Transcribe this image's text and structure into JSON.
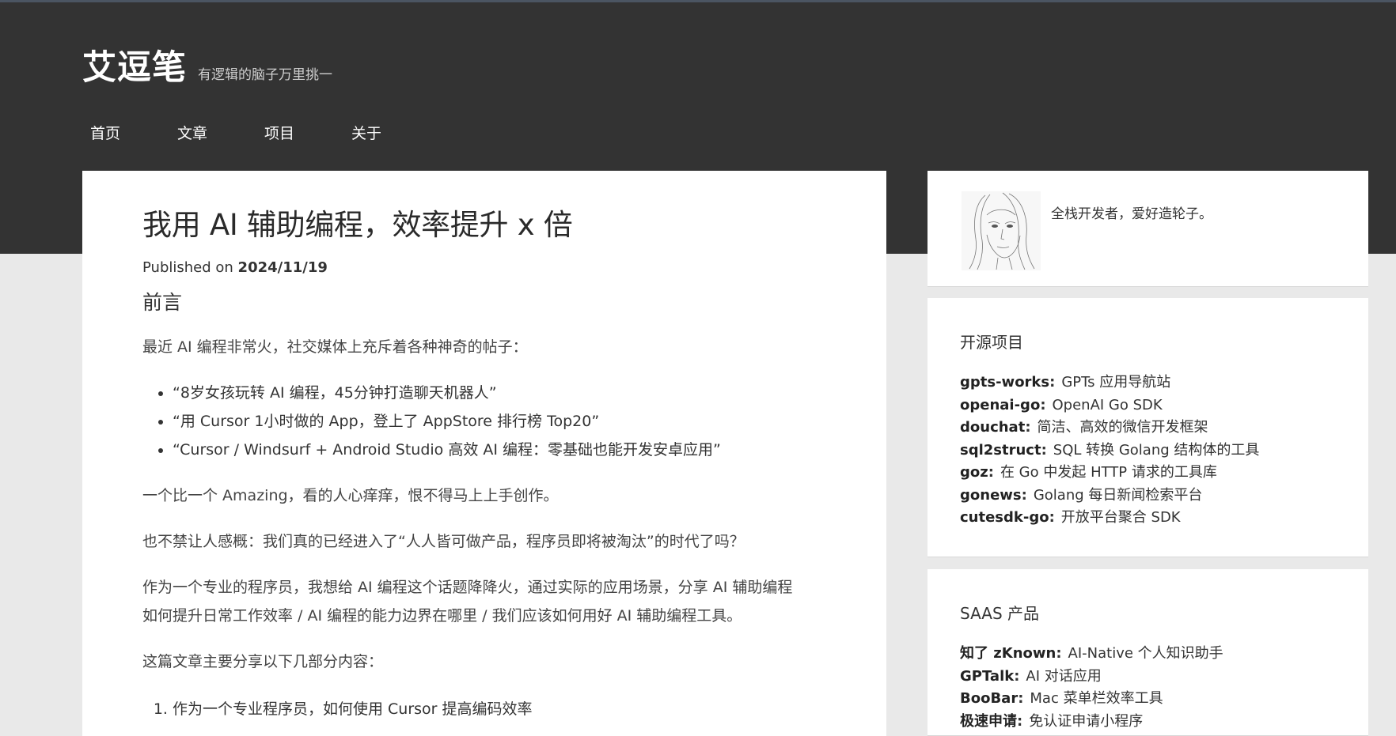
{
  "site": {
    "title": "艾逗笔",
    "tagline": "有逻辑的脑子万里挑一"
  },
  "nav": [
    "首页",
    "文章",
    "项目",
    "关于"
  ],
  "post": {
    "title": "我用 AI 辅助编程，效率提升 x 倍",
    "published_label": "Published on",
    "date": "2024/11/19",
    "section": "前言",
    "intro": "最近 AI 编程非常火，社交媒体上充斥着各种神奇的帖子：",
    "bullets": [
      "“8岁女孩玩转 AI 编程，45分钟打造聊天机器人”",
      "“用 Cursor 1小时做的 App，登上了 AppStore 排行榜 Top20”",
      "“Cursor / Windsurf + Android Studio 高效 AI 编程：零基础也能开发安卓应用”"
    ],
    "p2": "一个比一个 Amazing，看的人心痒痒，恨不得马上上手创作。",
    "p3": "也不禁让人感概：我们真的已经进入了“人人皆可做产品，程序员即将被淘汰”的时代了吗？",
    "p4_line1": "作为一个专业的程序员，我想给 AI 编程这个话题降降火，通过实际的应用场景，分享 AI 辅助编程",
    "p4_line2": "如何提升日常工作效率 / AI 编程的能力边界在哪里 / 我们应该如何用好 AI 辅助编程工具。",
    "p5": "这篇文章主要分享以下几部分内容：",
    "parts": [
      "作为一个专业程序员，如何使用 Cursor 提高编码效率"
    ]
  },
  "profile": {
    "bio": "全栈开发者，爱好造轮子。"
  },
  "projects": {
    "title": "开源项目",
    "items": [
      {
        "name": "gpts-works",
        "desc": "GPTs 应用导航站"
      },
      {
        "name": "openai-go",
        "desc": "OpenAI Go SDK"
      },
      {
        "name": "douchat",
        "desc": "简洁、高效的微信开发框架"
      },
      {
        "name": "sql2struct",
        "desc": "SQL 转换 Golang 结构体的工具"
      },
      {
        "name": "goz",
        "desc": "在 Go 中发起 HTTP 请求的工具库"
      },
      {
        "name": "gonews",
        "desc": "Golang 每日新闻检索平台"
      },
      {
        "name": "cutesdk-go",
        "desc": "开放平台聚合 SDK"
      }
    ]
  },
  "saas": {
    "title": "SAAS 产品",
    "items": [
      {
        "name": "知了 zKnown",
        "desc": "AI-Native 个人知识助手"
      },
      {
        "name": "GPTalk",
        "desc": "AI 对话应用"
      },
      {
        "name": "BooBar",
        "desc": "Mac 菜单栏效率工具"
      },
      {
        "name": "极速申请",
        "desc": "免认证申请小程序"
      }
    ]
  },
  "colors": {
    "header_bg": "#333333",
    "page_bg": "#e9e9e9",
    "card_bg": "#ffffff"
  }
}
